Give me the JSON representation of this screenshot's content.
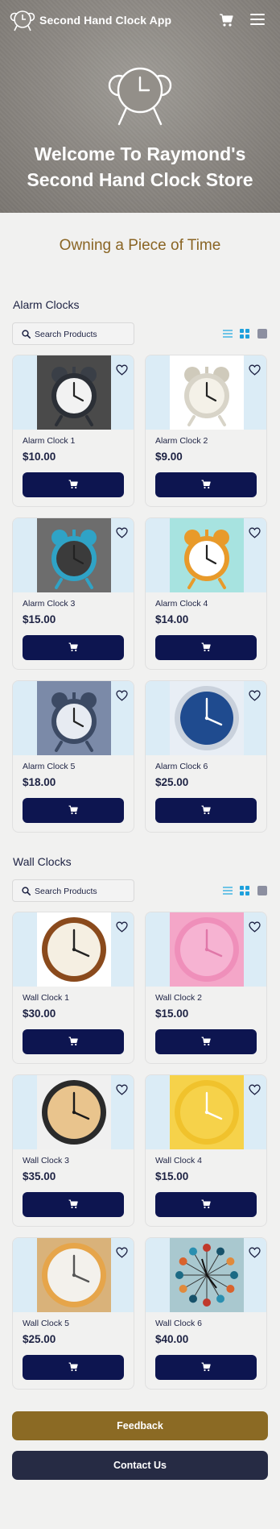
{
  "app": {
    "title": "Second Hand Clock App"
  },
  "hero": {
    "heading_line1": "Welcome To Raymond's",
    "heading_line2": "Second Hand Clock Store"
  },
  "tagline": "Owning a Piece of Time",
  "colors": {
    "accent_brown": "#8b6a24",
    "navy_button": "#0d1550",
    "contact_button": "#262b44",
    "card_image_bg": "#dbecf6",
    "toggle_blue": "#1ea0dc",
    "toggle_light_blue": "#6fc4e6"
  },
  "icons": [
    "clock-logo-icon",
    "cart-icon",
    "menu-icon",
    "heart-icon",
    "search-icon",
    "list-view-icon",
    "grid-view-icon",
    "square-view-icon"
  ],
  "sections": [
    {
      "title": "Alarm Clocks",
      "search_placeholder": "Search Products",
      "products": [
        {
          "name": "Alarm Clock 1",
          "price": "$10.00"
        },
        {
          "name": "Alarm Clock 2",
          "price": "$9.00"
        },
        {
          "name": "Alarm Clock 3",
          "price": "$15.00"
        },
        {
          "name": "Alarm Clock 4",
          "price": "$14.00"
        },
        {
          "name": "Alarm Clock 5",
          "price": "$18.00"
        },
        {
          "name": "Alarm Clock 6",
          "price": "$25.00"
        }
      ]
    },
    {
      "title": "Wall Clocks",
      "search_placeholder": "Search Products",
      "products": [
        {
          "name": "Wall Clock 1",
          "price": "$30.00"
        },
        {
          "name": "Wall Clock 2",
          "price": "$15.00"
        },
        {
          "name": "Wall Clock 3",
          "price": "$35.00"
        },
        {
          "name": "Wall Clock 4",
          "price": "$15.00"
        },
        {
          "name": "Wall Clock 5",
          "price": "$25.00"
        },
        {
          "name": "Wall Clock 6",
          "price": "$40.00"
        }
      ]
    }
  ],
  "buttons": {
    "feedback": "Feedback",
    "contact": "Contact Us"
  }
}
